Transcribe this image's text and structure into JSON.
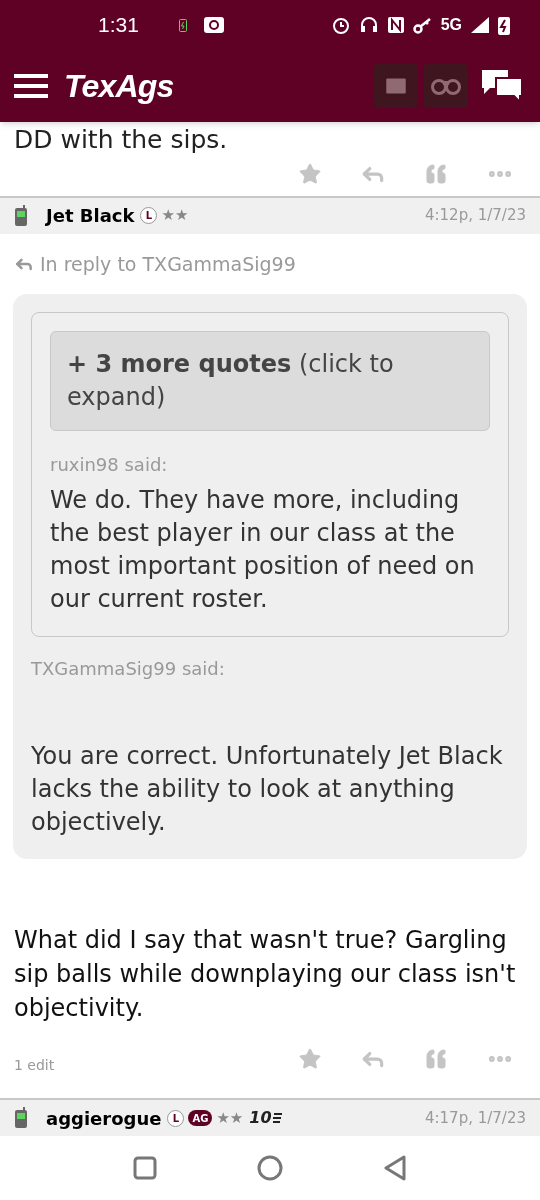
{
  "status_bar": {
    "time": "1:31",
    "network": "5G"
  },
  "header": {
    "logo": "TexAgs"
  },
  "previous_post": {
    "text": "DD with the sips."
  },
  "posts": [
    {
      "author": "Jet Black",
      "badges": [
        {
          "kind": "letter",
          "label": "L"
        }
      ],
      "rank_stars": "★★",
      "time": "4:12p, 1/7/23",
      "reply_to": "In reply to TXGammaSig99",
      "quote": {
        "said": "TXGammaSig99 said:",
        "expand": "**+ 3 more quotes** (click to expand)",
        "inner_said": "ruxin98 said:",
        "inner_text": "We do. They have more, including the best player in our class at the most important position of need on our current roster.",
        "text": "You are correct. Unfortunately Jet Black lacks the ability to look at anything objectively."
      },
      "body": "What did I say that wasn't true? Gargling sip balls while downplaying our class isn't objectivity.",
      "edits": "1 edit"
    },
    {
      "author": "aggierogue",
      "badges": [
        {
          "kind": "letter",
          "label": "L"
        },
        {
          "kind": "team",
          "label": "AG"
        }
      ],
      "rank_stars": "★★",
      "rank": "10",
      "time": "4:17p, 1/7/23"
    }
  ]
}
